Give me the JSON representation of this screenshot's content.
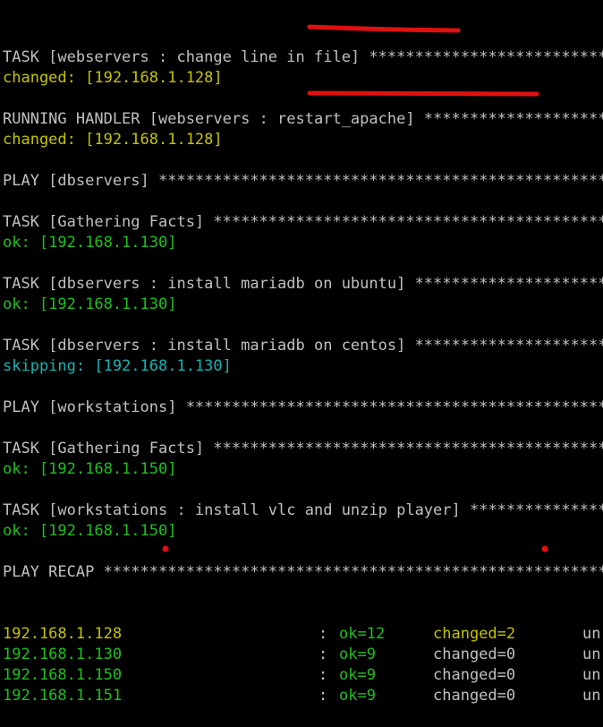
{
  "terminal": {
    "lines": [
      {
        "text": "TASK [webservers : change line in file] **************************",
        "color": "white"
      },
      {
        "text": "changed: [192.168.1.128]",
        "color": "yellow"
      },
      {
        "text": "",
        "color": "white"
      },
      {
        "text": "RUNNING HANDLER [webservers : restart_apache] ********************",
        "color": "white"
      },
      {
        "text": "changed: [192.168.1.128]",
        "color": "yellow"
      },
      {
        "text": "",
        "color": "white"
      },
      {
        "text": "PLAY [dbservers] *************************************************",
        "color": "white"
      },
      {
        "text": "",
        "color": "white"
      },
      {
        "text": "TASK [Gathering Facts] *******************************************",
        "color": "white"
      },
      {
        "text": "ok: [192.168.1.130]",
        "color": "green"
      },
      {
        "text": "",
        "color": "white"
      },
      {
        "text": "TASK [dbservers : install mariadb on ubuntu] *********************",
        "color": "white"
      },
      {
        "text": "ok: [192.168.1.130]",
        "color": "green"
      },
      {
        "text": "",
        "color": "white"
      },
      {
        "text": "TASK [dbservers : install mariadb on centos] *********************",
        "color": "white"
      },
      {
        "text": "skipping: [192.168.1.130]",
        "color": "cyan"
      },
      {
        "text": "",
        "color": "white"
      },
      {
        "text": "PLAY [workstations] **********************************************",
        "color": "white"
      },
      {
        "text": "",
        "color": "white"
      },
      {
        "text": "TASK [Gathering Facts] *******************************************",
        "color": "white"
      },
      {
        "text": "ok: [192.168.1.150]",
        "color": "green"
      },
      {
        "text": "",
        "color": "white"
      },
      {
        "text": "TASK [workstations : install vlc and unzip player] ***************",
        "color": "white"
      },
      {
        "text": "ok: [192.168.1.150]",
        "color": "green"
      },
      {
        "text": "",
        "color": "white"
      },
      {
        "text": "PLAY RECAP *******************************************************",
        "color": "white"
      }
    ],
    "recap": [
      {
        "host": "192.168.1.128",
        "host_color": "yellow",
        "colon": ":",
        "ok": "ok=12",
        "changed": "changed=2",
        "changed_color": "yellow",
        "unreachable": "un"
      },
      {
        "host": "192.168.1.130",
        "host_color": "green",
        "colon": ":",
        "ok": "ok=9",
        "changed": "changed=0",
        "changed_color": "white",
        "unreachable": "un"
      },
      {
        "host": "192.168.1.150",
        "host_color": "green",
        "colon": ":",
        "ok": "ok=9",
        "changed": "changed=0",
        "changed_color": "white",
        "unreachable": "un"
      },
      {
        "host": "192.168.1.151",
        "host_color": "green",
        "colon": ":",
        "ok": "ok=9",
        "changed": "changed=0",
        "changed_color": "white",
        "unreachable": "un"
      }
    ]
  },
  "colors": {
    "background": "#000000",
    "white": "#c0c0c0",
    "yellow": "#c4c400",
    "green": "#1fbf1f",
    "cyan": "#18b2b2",
    "annotation_red": "#e01010"
  }
}
